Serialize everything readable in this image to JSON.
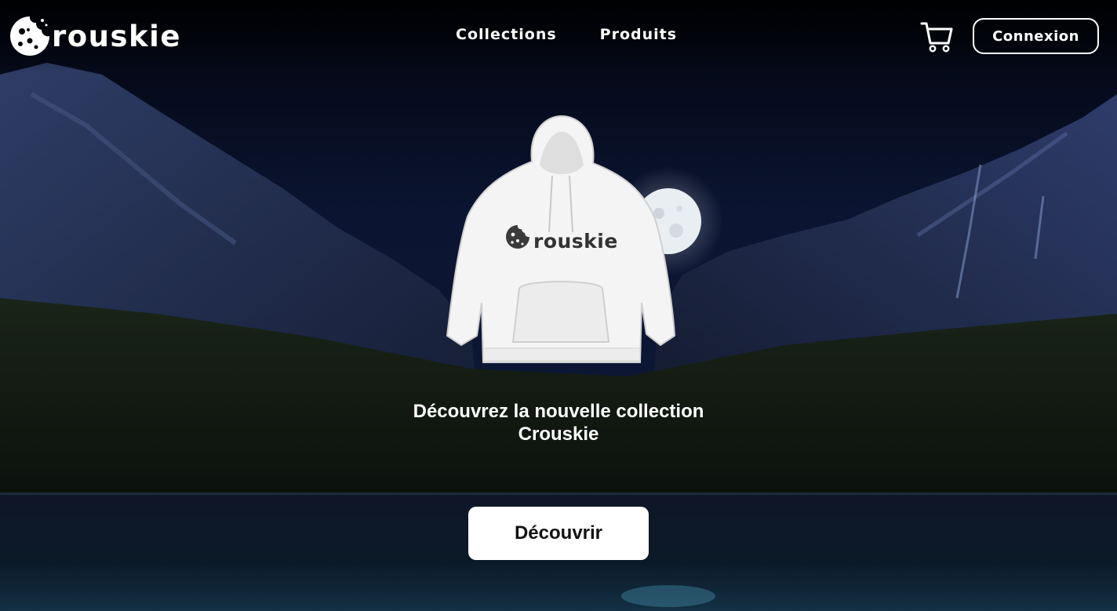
{
  "brand": {
    "logo_text": "rouskie"
  },
  "nav": {
    "links": [
      "Collections",
      "Produits"
    ]
  },
  "header": {
    "login_label": "Connexion",
    "cart_icon": "shopping-cart-icon"
  },
  "hero": {
    "product_print": "rouskie",
    "headline_line1": "Découvrez la nouvelle collection",
    "headline_line2": "Crouskie",
    "cta_label": "Découvrir"
  },
  "colors": {
    "background": "#0a1020",
    "primary_text": "#ffffff",
    "cta_background": "#ffffff",
    "cta_text": "#111111"
  }
}
